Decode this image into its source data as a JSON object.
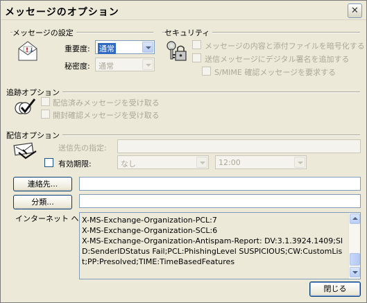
{
  "window": {
    "title": "メッセージのオプション",
    "close_glyph": "✕"
  },
  "settings": {
    "section_label": "メッセージの設定",
    "importance_label": "重要度:",
    "importance_value": "通常",
    "sensitivity_label": "秘密度:",
    "sensitivity_value": "通常"
  },
  "security": {
    "section_label": "セキュリティ",
    "encrypt_label": "メッセージの内容と添付ファイルを暗号化する",
    "sign_label": "送信メッセージにデジタル署名を追加する",
    "smime_label": "S/MIME 確認メッセージを要求する"
  },
  "tracking": {
    "section_label": "追跡オプション",
    "delivery_label": "配信済みメッセージを受け取る",
    "read_label": "開封確認メッセージを受け取る"
  },
  "delivery": {
    "section_label": "配信オプション",
    "reply_to_label": "送信先の指定:",
    "expires_label": "有効期限:",
    "expires_date": "なし",
    "expires_time": "12:00"
  },
  "buttons": {
    "contacts": "連絡先...",
    "categories": "分類...",
    "close": "閉じる"
  },
  "headers": {
    "label": "インターネット ヘッダー:",
    "text": "X-MS-Exchange-Organization-PCL:7\nX-MS-Exchange-Organization-SCL:6\nX-MS-Exchange-Organization-Antispam-Report: DV:3.1.3924.1409;SID:SenderIDStatus Fail;PCL:PhishingLevel SUSPICIOUS;CW:CustomList;PP:Presolved;TIME:TimeBasedFeatures"
  },
  "icons": {
    "settings": "envelope-importance-icon",
    "security": "keys-lock-icon",
    "tracking": "tracking-check-icon",
    "delivery": "delivery-envelope-icon"
  }
}
